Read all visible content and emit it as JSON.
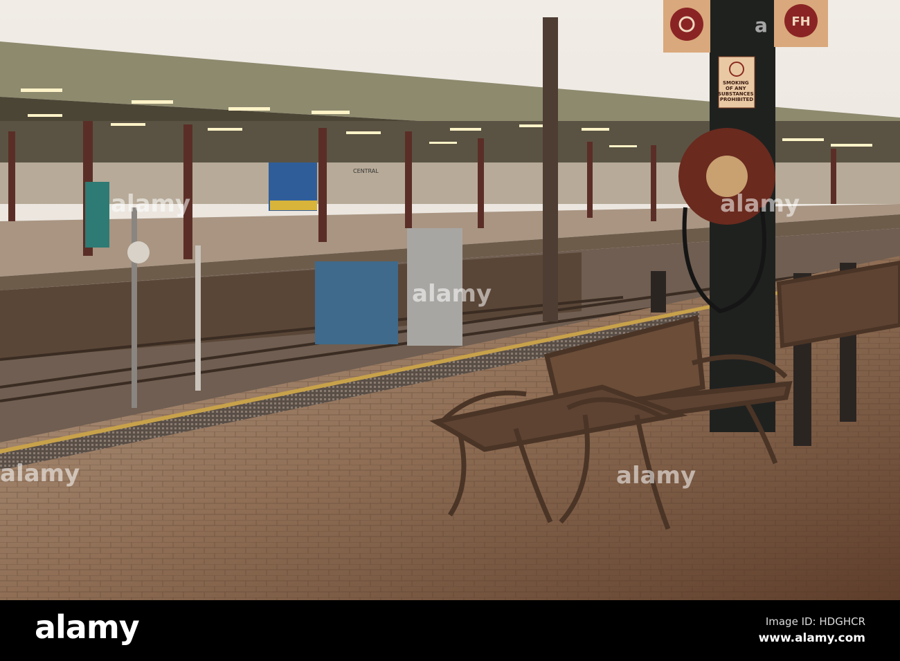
{
  "photo": {
    "signs": {
      "fire_hose": "FH",
      "no_smoking": [
        "SMOKING",
        "OF ANY",
        "SUBSTANCES",
        "PROHIBITED"
      ],
      "train_destination": "CENTRAL"
    },
    "watermark": "alamy",
    "watermark_letter": "a"
  },
  "footer": {
    "logo": "alamy",
    "image_id": "Image ID: HDGHCR",
    "url": "www.alamy.com"
  }
}
